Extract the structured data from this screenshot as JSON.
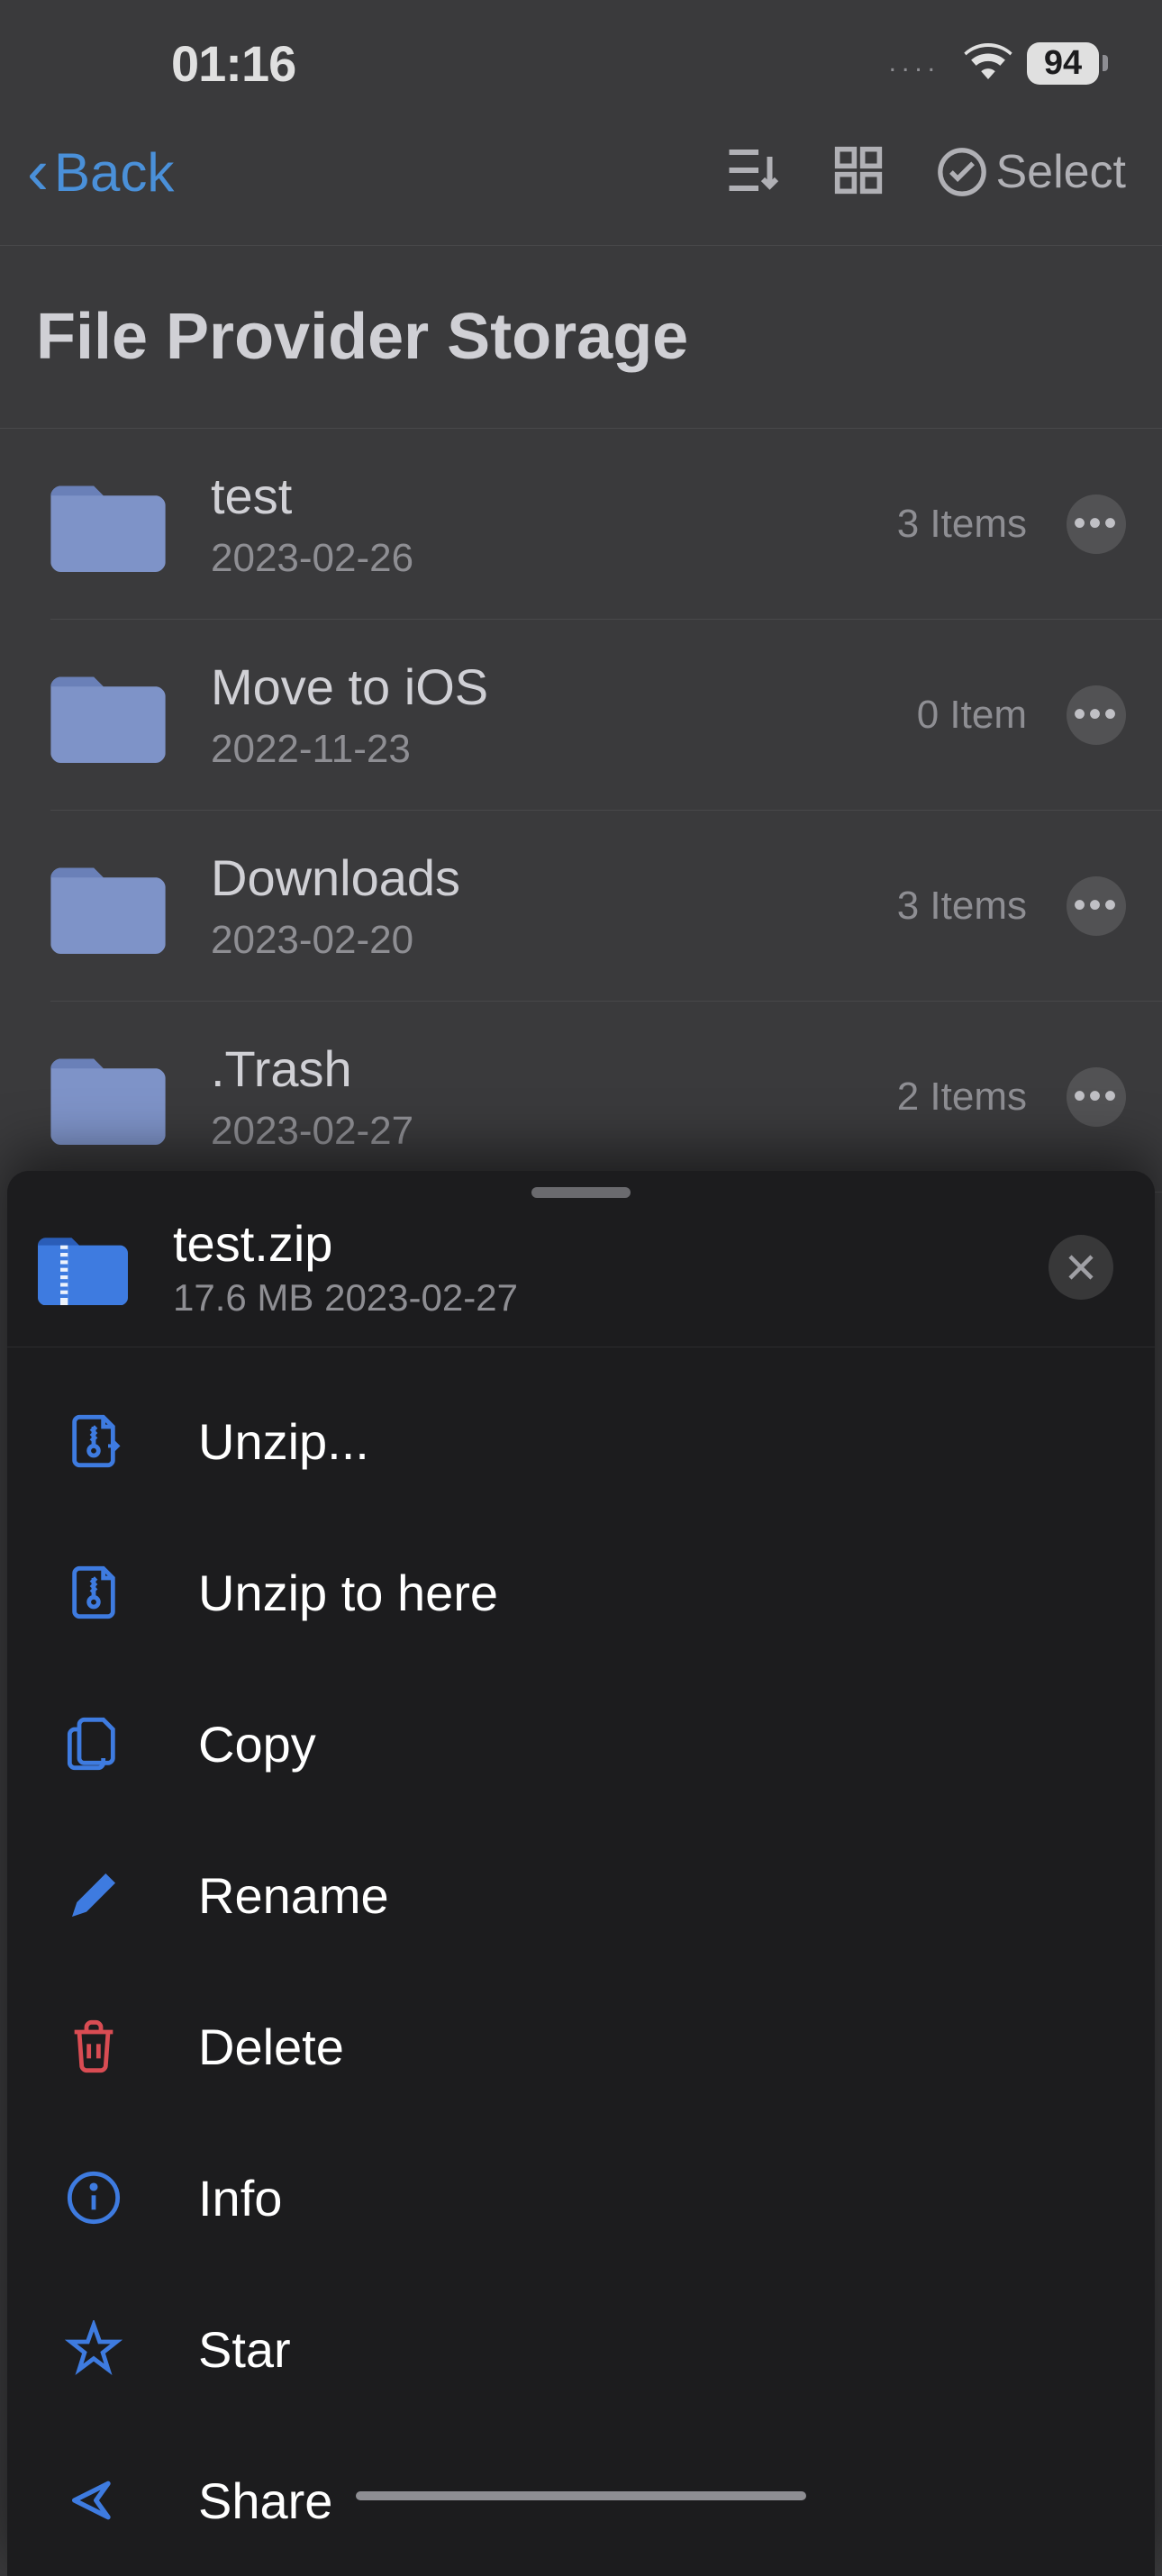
{
  "status": {
    "time": "01:16",
    "battery": "94"
  },
  "nav": {
    "back_label": "Back",
    "select_label": "Select"
  },
  "page_title": "File Provider Storage",
  "files": [
    {
      "name": "test",
      "date": "2023-02-26",
      "items": "3 Items"
    },
    {
      "name": "Move to iOS",
      "date": "2022-11-23",
      "items": "0 Item"
    },
    {
      "name": "Downloads",
      "date": "2023-02-20",
      "items": "3 Items"
    },
    {
      "name": ".Trash",
      "date": "2023-02-27",
      "items": "2 Items"
    }
  ],
  "sheet": {
    "file_name": "test.zip",
    "file_meta": "17.6 MB 2023-02-27",
    "actions": {
      "unzip": "Unzip...",
      "unzip_here": "Unzip to here",
      "copy": "Copy",
      "rename": "Rename",
      "delete": "Delete",
      "info": "Info",
      "star": "Star",
      "share": "Share"
    }
  },
  "colors": {
    "accent": "#3e7be0",
    "danger": "#d94c53"
  }
}
